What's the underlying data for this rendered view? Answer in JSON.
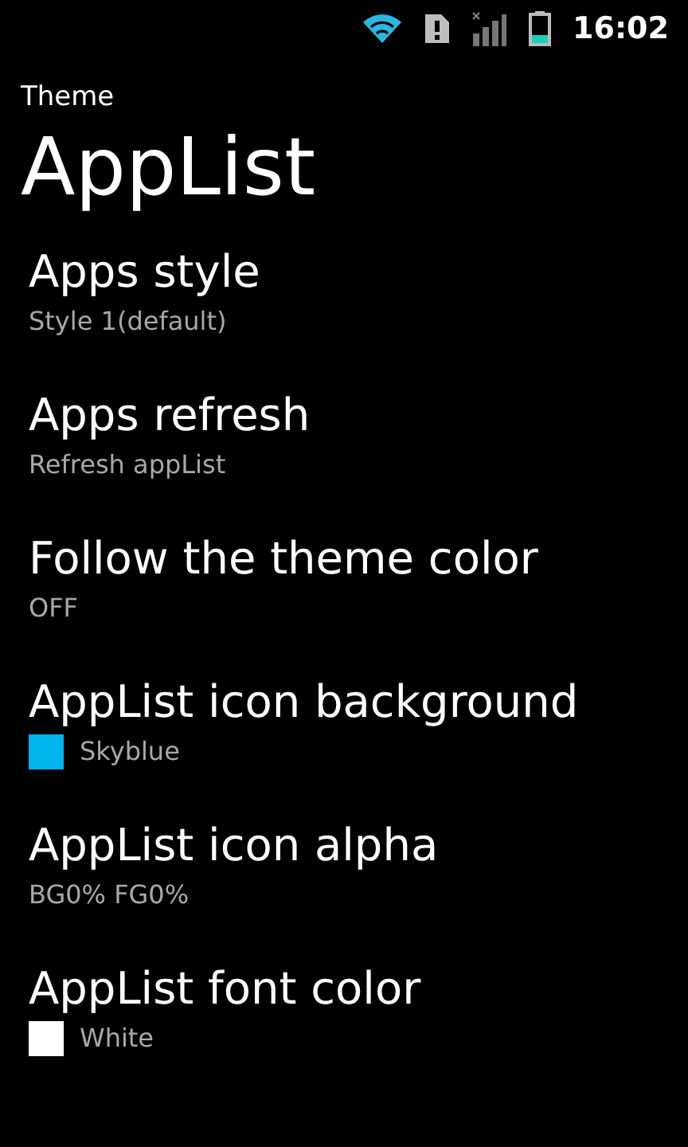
{
  "status_bar": {
    "time": "16:02"
  },
  "header": {
    "subtitle": "Theme",
    "title": "AppList"
  },
  "items": [
    {
      "kind": "text",
      "title": "Apps style",
      "summary": "Style 1(default)"
    },
    {
      "kind": "text",
      "title": "Apps refresh",
      "summary": "Refresh appList"
    },
    {
      "kind": "text",
      "title": "Follow the theme color",
      "summary": "OFF"
    },
    {
      "kind": "swatch",
      "title": "AppList icon background",
      "summary": "Skyblue",
      "color": "#00b4ee"
    },
    {
      "kind": "text",
      "title": "AppList icon alpha",
      "summary": "BG0% FG0%"
    },
    {
      "kind": "swatch",
      "title": "AppList font color",
      "summary": "White",
      "color": "#ffffff"
    }
  ]
}
